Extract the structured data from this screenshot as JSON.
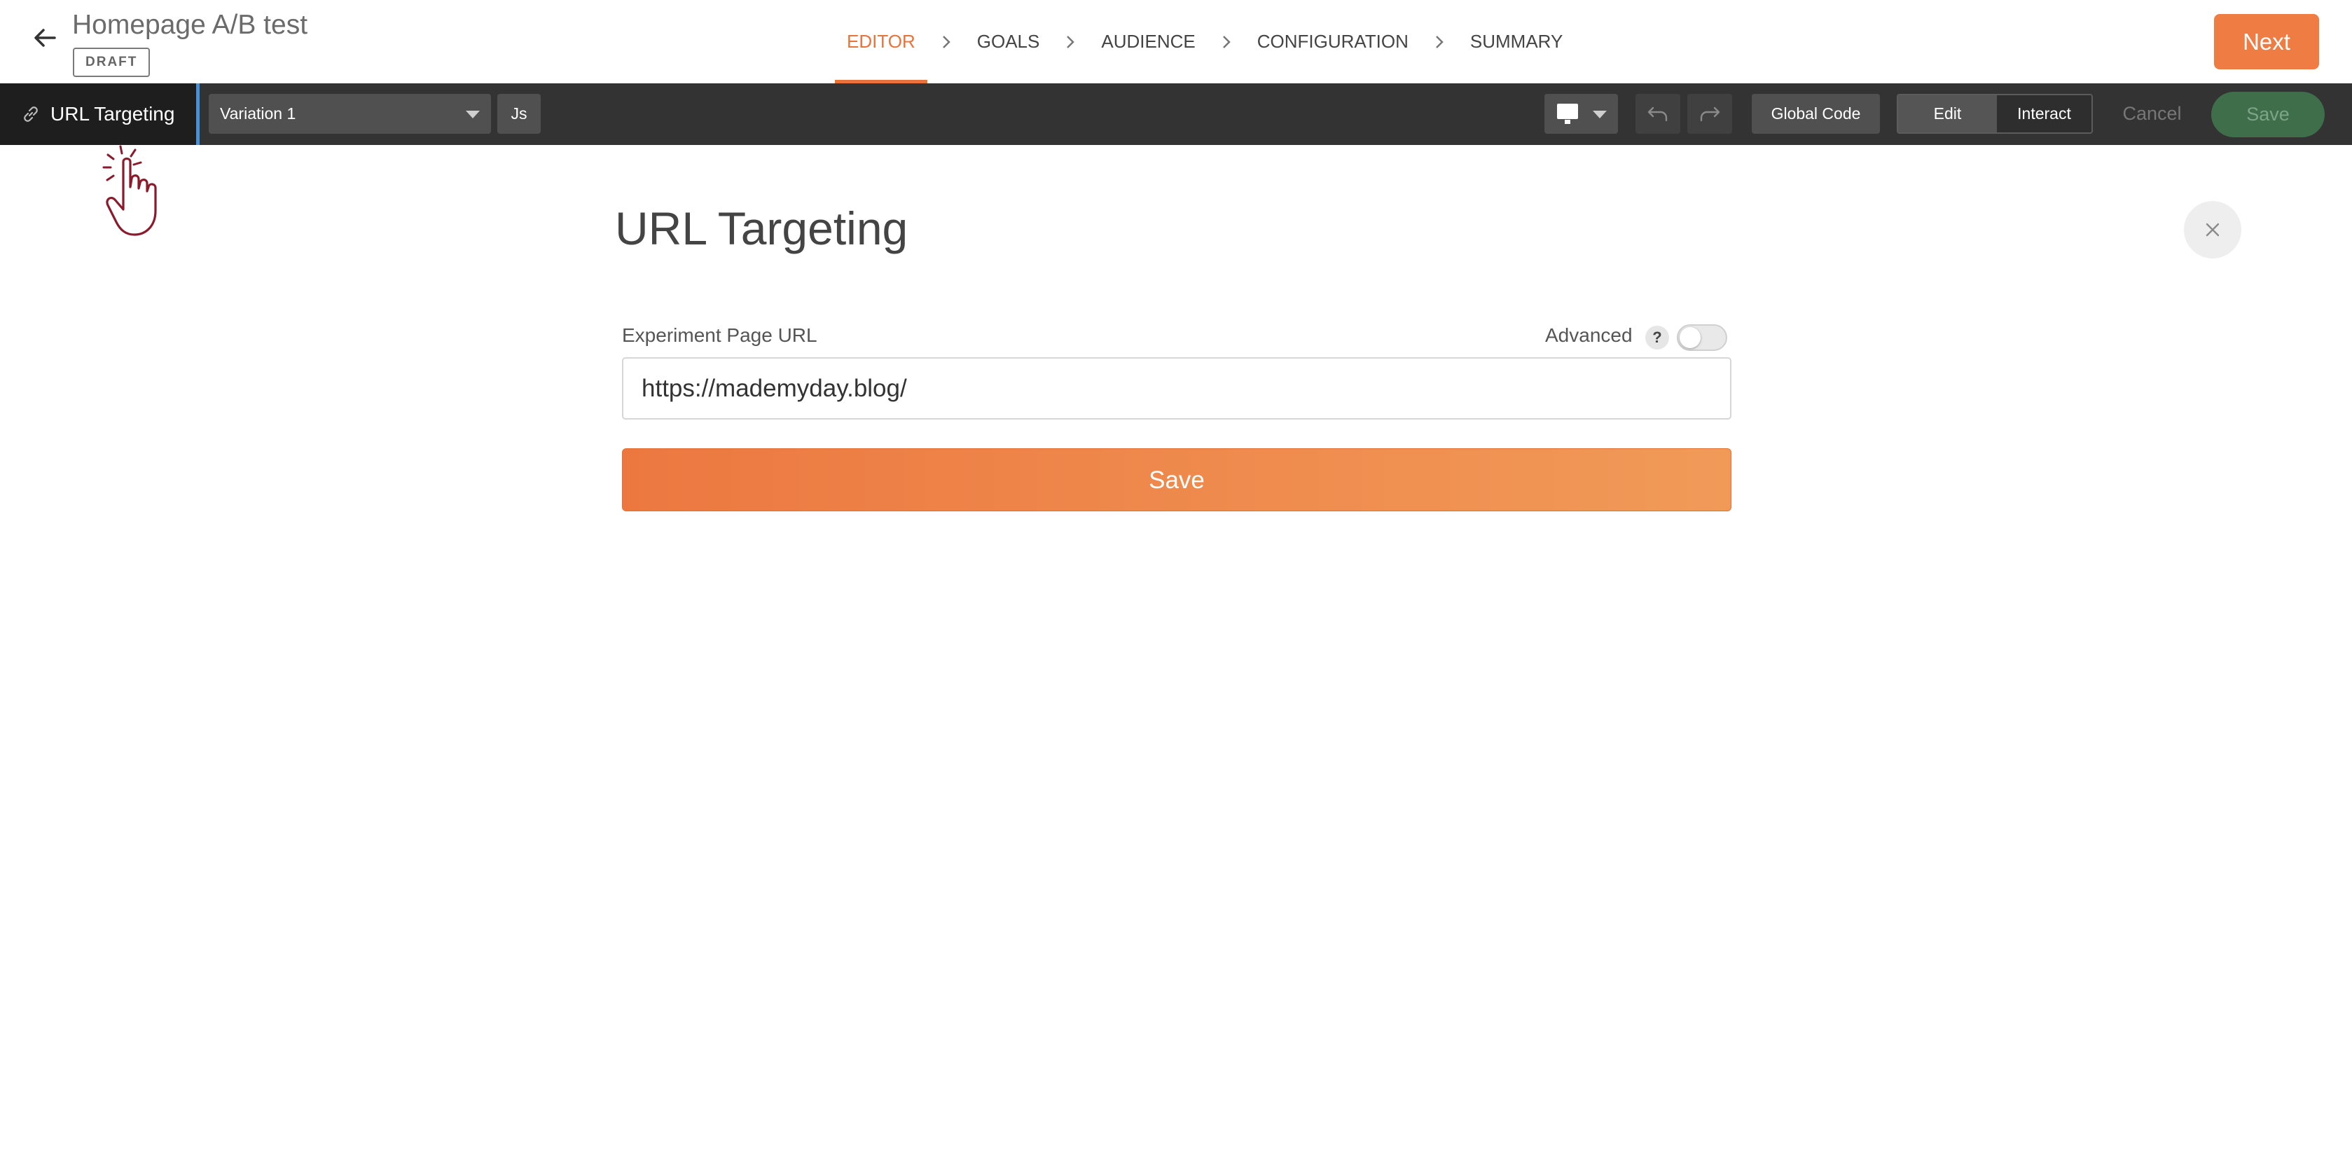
{
  "header": {
    "title": "Homepage A/B test",
    "status_badge": "DRAFT",
    "steps": [
      {
        "label": "EDITOR",
        "active": true
      },
      {
        "label": "GOALS",
        "active": false
      },
      {
        "label": "AUDIENCE",
        "active": false
      },
      {
        "label": "CONFIGURATION",
        "active": false
      },
      {
        "label": "SUMMARY",
        "active": false
      }
    ],
    "next_label": "Next"
  },
  "toolbar": {
    "url_targeting_tab": "URL Targeting",
    "variation_selected": "Variation 1",
    "js_label": "Js",
    "device": "desktop-icon",
    "global_code_label": "Global Code",
    "mode_edit_label": "Edit",
    "mode_interact_label": "Interact",
    "active_mode": "Edit",
    "cancel_label": "Cancel",
    "save_label": "Save"
  },
  "panel": {
    "title": "URL Targeting",
    "field_label": "Experiment Page URL",
    "advanced_label": "Advanced",
    "help_icon_text": "?",
    "advanced_enabled": false,
    "url_value": "https://mademyday.blog/",
    "save_label": "Save"
  },
  "colors": {
    "accent_orange": "#ef7d43",
    "toolbar_dark": "#333333",
    "tab_dark": "#1e1e1e",
    "tab_accent_blue": "#4a90d9",
    "save_green": "#3f6e4a",
    "cursor_red": "#8b1a2b"
  },
  "icons": {
    "back": "arrow-left-icon",
    "link": "link-icon",
    "undo": "undo-icon",
    "redo": "redo-icon",
    "close": "close-icon",
    "cursor": "hand-pointer-icon"
  }
}
